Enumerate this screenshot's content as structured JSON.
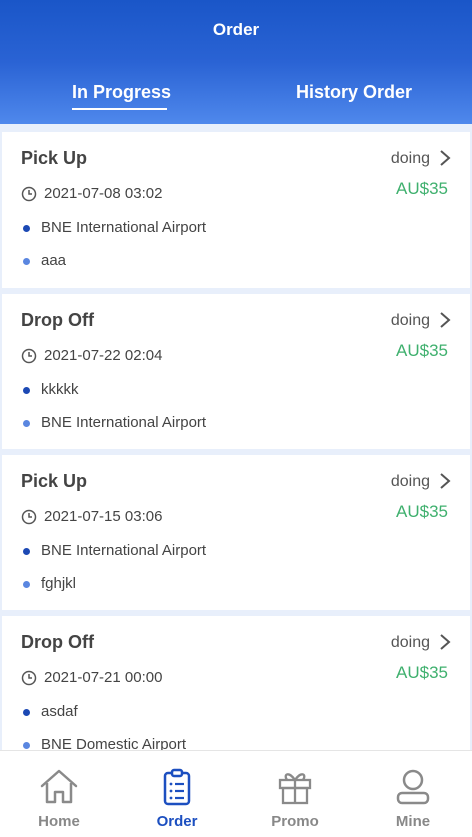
{
  "header": {
    "title": "Order",
    "tabs": [
      {
        "label": "In Progress",
        "active": true
      },
      {
        "label": "History Order",
        "active": false
      }
    ]
  },
  "orders": [
    {
      "type": "Pick Up",
      "status": "doing",
      "price": "AU$35",
      "datetime": "2021-07-08 03:02",
      "from": "BNE International Airport",
      "to": "aaa"
    },
    {
      "type": "Drop Off",
      "status": "doing",
      "price": "AU$35",
      "datetime": "2021-07-22 02:04",
      "from": "kkkkk",
      "to": "BNE International Airport"
    },
    {
      "type": "Pick Up",
      "status": "doing",
      "price": "AU$35",
      "datetime": "2021-07-15 03:06",
      "from": "BNE International Airport",
      "to": "fghjkl"
    },
    {
      "type": "Drop Off",
      "status": "doing",
      "price": "AU$35",
      "datetime": "2021-07-21 00:00",
      "from": "asdaf",
      "to": "BNE Domestic Airport"
    }
  ],
  "tabbar": {
    "items": [
      {
        "label": "Home",
        "icon": "home-icon",
        "active": false
      },
      {
        "label": "Order",
        "icon": "clipboard-icon",
        "active": true
      },
      {
        "label": "Promo",
        "icon": "gift-icon",
        "active": false
      },
      {
        "label": "Mine",
        "icon": "user-icon",
        "active": false
      }
    ]
  },
  "colors": {
    "brand": "#1c4fc0",
    "price": "#3fb06e",
    "inactive": "#888888"
  }
}
